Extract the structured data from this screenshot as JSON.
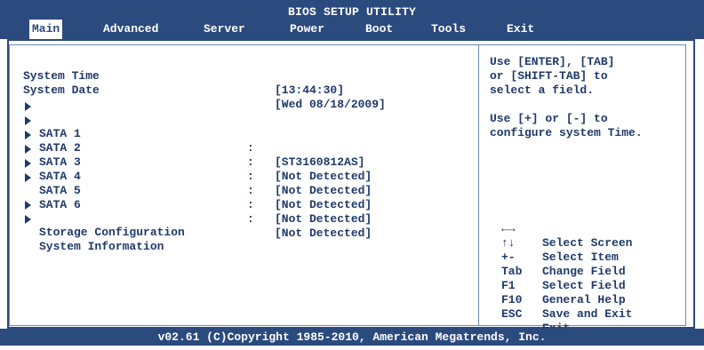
{
  "header": {
    "title": "BIOS SETUP UTILITY"
  },
  "menu": {
    "tabs": [
      {
        "label": "Main"
      },
      {
        "label": "Advanced"
      },
      {
        "label": "Server"
      },
      {
        "label": "Power"
      },
      {
        "label": "Boot"
      },
      {
        "label": "Tools"
      },
      {
        "label": "Exit"
      }
    ],
    "active": "Main"
  },
  "main": {
    "system_time": {
      "label": "System Time",
      "value": "[13:44:30]"
    },
    "system_date": {
      "label": "System Date",
      "value": "[Wed 08/18/2009]"
    },
    "sata": [
      {
        "label": "SATA 1",
        "colon": ":",
        "value": "[ST3160812AS]"
      },
      {
        "label": "SATA 2",
        "colon": ":",
        "value": "[Not Detected]"
      },
      {
        "label": "SATA 3",
        "colon": ":",
        "value": "[Not Detected]"
      },
      {
        "label": "SATA 4",
        "colon": ":",
        "value": "[Not Detected]"
      },
      {
        "label": "SATA 5",
        "colon": ":",
        "value": "[Not Detected]"
      },
      {
        "label": "SATA 6",
        "colon": ":",
        "value": "[Not Detected]"
      }
    ],
    "submenus": [
      {
        "label": "Storage Configuration"
      },
      {
        "label": "System Information"
      }
    ]
  },
  "help": {
    "lines": [
      "Use [ENTER], [TAB]",
      "or [SHIFT-TAB] to",
      "select a field.",
      "",
      "Use [+] or [-] to",
      "configure system Time."
    ]
  },
  "keys": [
    {
      "key": "←→",
      "desc": "Select Screen"
    },
    {
      "key": "↑↓",
      "desc": "Select Item"
    },
    {
      "key": "+-",
      "desc": "Change Field"
    },
    {
      "key": "Tab",
      "desc": "Select Field"
    },
    {
      "key": "F1",
      "desc": "General Help"
    },
    {
      "key": "F10",
      "desc": "Save and Exit"
    },
    {
      "key": "ESC",
      "desc": "Exit"
    }
  ],
  "footer": {
    "text": "v02.61 (C)Copyright 1985-2010, American Megatrends, Inc."
  },
  "colors": {
    "bar": "#2b4a7e",
    "text": "#1f3a6a",
    "background": "#ffffff"
  }
}
